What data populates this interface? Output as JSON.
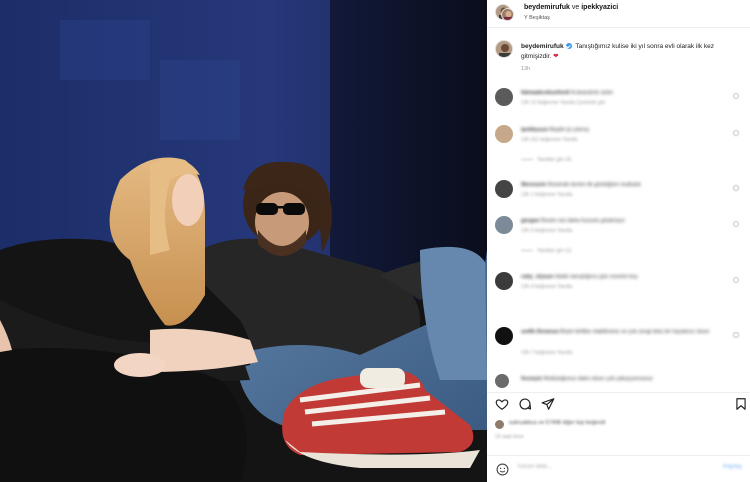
{
  "post": {
    "users": "beydemirufuk",
    "conjunction": "ve",
    "collaborator": "ipekkyazici",
    "location": "Y Beşiktaş"
  },
  "caption": {
    "username": "beydemirufuk",
    "text": "Tanıştığımız kulise iki yıl sonra evli olarak ilk kez gitmişizdir.",
    "heart": "❤",
    "time": "13h"
  },
  "comments": [
    {
      "user": "fatmaakcekunfonit",
      "text": "Kıskandırdı sizler",
      "meta": "13h  12 beğenme  Yanıtla  Çevirisini gör",
      "color": "#5b5b5b"
    },
    {
      "user": "ipekbysun",
      "text": "Başlık iyi çıkmış",
      "meta": "13h  311 beğenme  Yanıtla",
      "replies": "Yanıtları gör (4)",
      "color": "#c6a98a"
    },
    {
      "user": "fikrenurie",
      "text": "Resimde benim ilk gördüğüm mutluluk",
      "meta": "13h  1 beğenme  Yanıtla",
      "color": "#444444"
    },
    {
      "user": "gergan",
      "text": "Resim sizi daha huzurlu gösteriyor",
      "meta": "13h  9 beğenme  Yanıtla",
      "replies": "Yanıtları gör (1)",
      "color": "#7d8a99"
    },
    {
      "user": "ruby_elysun",
      "text": "Hadiıı tanıştığınız gün resmini koy",
      "meta": "13h  4 beğenme  Yanıtla",
      "color": "#3b3b3b"
    },
    {
      "user": "sedfe.floransa",
      "text": "Böyle birlikte olabilirsiniz ve çok sevgi dolu bir hayatınız olsun",
      "meta": "13h  7 beğenme  Yanıtla",
      "color": "#111111"
    },
    {
      "user": "fevzeyiz",
      "text": "Mutluluğunuz daim olsun çok yakışıyorsunuz",
      "meta": "",
      "color": "#6b6b6b"
    }
  ],
  "likes": {
    "text": "sukruakkus ve 57498 diğer kişi beğendi"
  },
  "date": "13 saat önce",
  "add_comment": {
    "placeholder": "Yorum ekle...",
    "post": "Paylaş"
  },
  "icons": [
    "more-icon",
    "verified-icon",
    "like-icon",
    "comment-icon",
    "share-icon",
    "save-icon",
    "emoji-icon"
  ]
}
